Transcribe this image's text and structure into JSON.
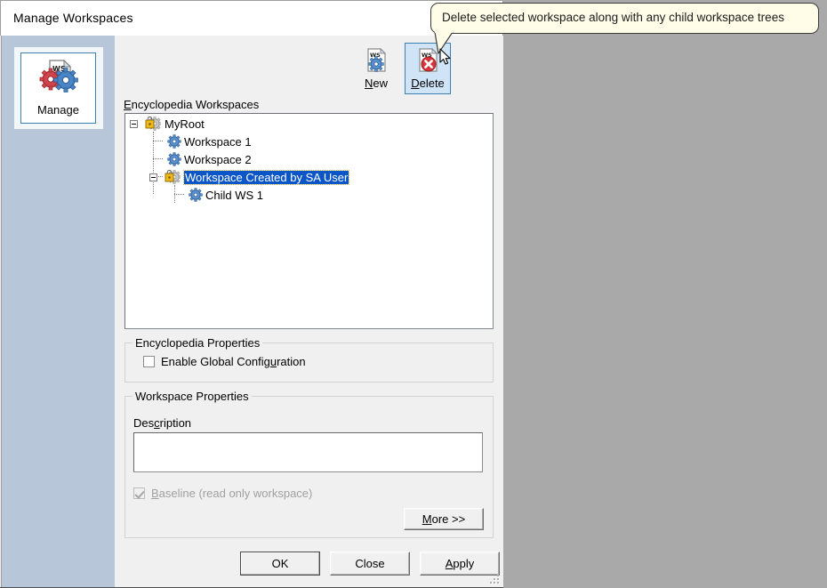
{
  "window": {
    "title": "Manage Workspaces"
  },
  "sidebar": {
    "manage_button": {
      "label": "Manage",
      "icon": "workspace-gears-document-icon"
    }
  },
  "toolbar": {
    "buttons": [
      {
        "label_prefix": "",
        "accel": "N",
        "label_suffix": "ew",
        "full_label": "New",
        "icon": "new-workspace-icon",
        "state": "normal"
      },
      {
        "label_prefix": "",
        "accel": "D",
        "label_suffix": "elete",
        "full_label": "Delete",
        "icon": "delete-workspace-icon",
        "state": "hovered"
      }
    ]
  },
  "tooltip": {
    "text": "Delete selected workspace along with any child workspace trees",
    "background": "#fffde8",
    "border": "#3b3b3b"
  },
  "tree": {
    "label_accel": "E",
    "label_rest": "ncyclopedia Workspaces",
    "label": "Encyclopedia Workspaces",
    "nodes": [
      {
        "label": "MyRoot",
        "icon": "locked-workspace-icon",
        "depth": 0,
        "expanded": true,
        "selected": false
      },
      {
        "label": "Workspace 1",
        "icon": "workspace-gear-icon",
        "depth": 1,
        "expanded": false,
        "selected": false
      },
      {
        "label": "Workspace 2",
        "icon": "workspace-gear-icon",
        "depth": 1,
        "expanded": false,
        "selected": false
      },
      {
        "label": "Workspace Created by SA User",
        "icon": "locked-workspace-icon",
        "depth": 1,
        "expanded": true,
        "selected": true
      },
      {
        "label": "Child WS 1",
        "icon": "workspace-gear-icon",
        "depth": 2,
        "expanded": false,
        "selected": false
      }
    ],
    "selection_color": "#0a55c8"
  },
  "encyclopedia_properties": {
    "group_title": "Encyclopedia Properties",
    "enable_global_configuration": {
      "label": "Enable Global Configuration",
      "label_accel": "u",
      "checked": false,
      "disabled": false
    }
  },
  "workspace_properties": {
    "group_title": "Workspace Properties",
    "description_label": "Description",
    "description_value": "",
    "description_placeholder": "",
    "baseline": {
      "label_prefix": "",
      "label_accel": "B",
      "label_suffix": "aseline (read only workspace)",
      "label": "Baseline (read only workspace)",
      "checked": true,
      "disabled": true
    },
    "more_button": {
      "label": "More >>",
      "accel": "M"
    }
  },
  "dialog_buttons": [
    {
      "label": "OK",
      "default": true
    },
    {
      "label": "Close",
      "default": false
    },
    {
      "label": "Apply",
      "accel": "A",
      "default": false
    }
  ]
}
